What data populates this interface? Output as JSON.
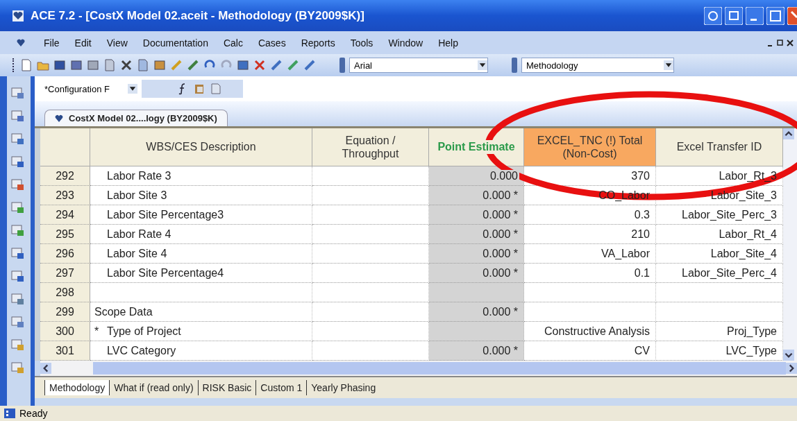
{
  "window": {
    "title": "ACE 7.2 - [CostX Model 02.aceit - Methodology (BY2009$K)]"
  },
  "menu": [
    "File",
    "Edit",
    "View",
    "Documentation",
    "Calc",
    "Cases",
    "Reports",
    "Tools",
    "Window",
    "Help"
  ],
  "toolbar": {
    "font_combo": "Arial",
    "view_combo": "Methodology"
  },
  "formula_bar": {
    "configuration_combo": "*Configuration F"
  },
  "document_tab": "CostX Model 02....logy (BY2009$K)",
  "table": {
    "columns": [
      {
        "kind": "rownum"
      },
      {
        "label": "WBS/CES Description",
        "kind": "normal"
      },
      {
        "label": "Equation /\nThroughput",
        "kind": "normal"
      },
      {
        "label": "Point Estimate",
        "kind": "green"
      },
      {
        "label": "EXCEL_TNC (!) Total\n(Non-Cost)",
        "kind": "highlight"
      },
      {
        "label": "Excel Transfer ID",
        "kind": "normal"
      }
    ],
    "rows": [
      {
        "number": "292",
        "kind": "item",
        "description": "Labor Rate 3",
        "point_estimate": "0.000",
        "tnc_total": "370",
        "transfer_id": "Labor_Rt_3"
      },
      {
        "number": "293",
        "kind": "item",
        "description": "Labor Site 3",
        "point_estimate": "0.000 *",
        "tnc_total": "CO_Labor",
        "transfer_id": "Labor_Site_3"
      },
      {
        "number": "294",
        "kind": "item",
        "description": "Labor Site Percentage3",
        "point_estimate": "0.000 *",
        "tnc_total": "0.3",
        "transfer_id": "Labor_Site_Perc_3"
      },
      {
        "number": "295",
        "kind": "item",
        "description": "Labor Rate 4",
        "point_estimate": "0.000 *",
        "tnc_total": "210",
        "transfer_id": "Labor_Rt_4"
      },
      {
        "number": "296",
        "kind": "item",
        "description": "Labor Site 4",
        "point_estimate": "0.000 *",
        "tnc_total": "VA_Labor",
        "transfer_id": "Labor_Site_4"
      },
      {
        "number": "297",
        "kind": "item",
        "description": "Labor Site Percentage4",
        "point_estimate": "0.000 *",
        "tnc_total": "0.1",
        "transfer_id": "Labor_Site_Perc_4"
      },
      {
        "number": "298",
        "kind": "item"
      },
      {
        "number": "299",
        "kind": "heading",
        "description": "Scope Data",
        "point_estimate": "0.000 *"
      },
      {
        "number": "300",
        "kind": "item",
        "marker": "*",
        "description": "Type of Project",
        "tnc_total": "Constructive Analysis",
        "transfer_id": "Proj_Type"
      },
      {
        "number": "301",
        "kind": "item",
        "description": "LVC Category",
        "point_estimate": "0.000 *",
        "tnc_total": "CV",
        "transfer_id": "LVC_Type"
      }
    ]
  },
  "sheet_tabs": [
    {
      "label": "Methodology",
      "selected": true
    },
    {
      "label": "What if (read only)",
      "selected": false
    },
    {
      "label": "RISK Basic",
      "selected": false
    },
    {
      "label": "Custom 1",
      "selected": false
    },
    {
      "label": "Yearly Phasing",
      "selected": false
    }
  ],
  "status_bar": "Ready"
}
